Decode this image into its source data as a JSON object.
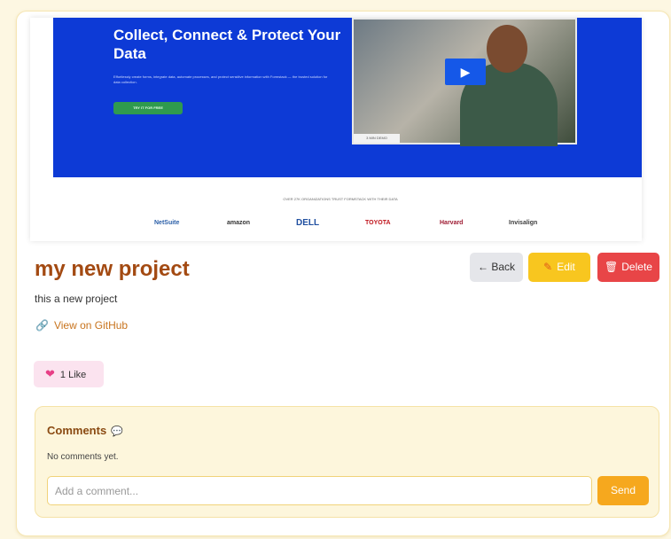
{
  "preview": {
    "headline": "Collect, Connect & Protect Your Data",
    "subtext": "Effortlessly create forms, integrate data, automate processes, and protect sensitive information with Formstack — the trusted solution for data collection.",
    "cta_label": "TRY IT FOR FREE",
    "video_caption": "3 MIN DEMO",
    "logos_title": "OVER 27K ORGANIZATIONS TRUST FORMSTACK WITH THEIR DATA",
    "logos": [
      "NetSuite",
      "amazon",
      "DELL",
      "TOYOTA",
      "Harvard",
      "Invisalign"
    ]
  },
  "project": {
    "title": "my new project",
    "description": "this a new project",
    "github_label": "View on GitHub"
  },
  "actions": {
    "back_label": "← Back",
    "edit_label": "Edit",
    "delete_label": "Delete"
  },
  "likes": {
    "label": "1 Like"
  },
  "comments": {
    "title": "Comments",
    "empty_text": "No comments yet.",
    "input_placeholder": "Add a comment...",
    "send_label": "Send"
  },
  "icons": {
    "link": "link-icon",
    "pencil": "pencil-icon",
    "trash": "trash-icon",
    "heart": "heart-icon",
    "chat": "chat-bubble-icon"
  },
  "colors": {
    "title": "#a34a12",
    "edit": "#f8c61f",
    "delete": "#e84547",
    "send": "#f6a81e",
    "hero": "#0d3ad6"
  }
}
